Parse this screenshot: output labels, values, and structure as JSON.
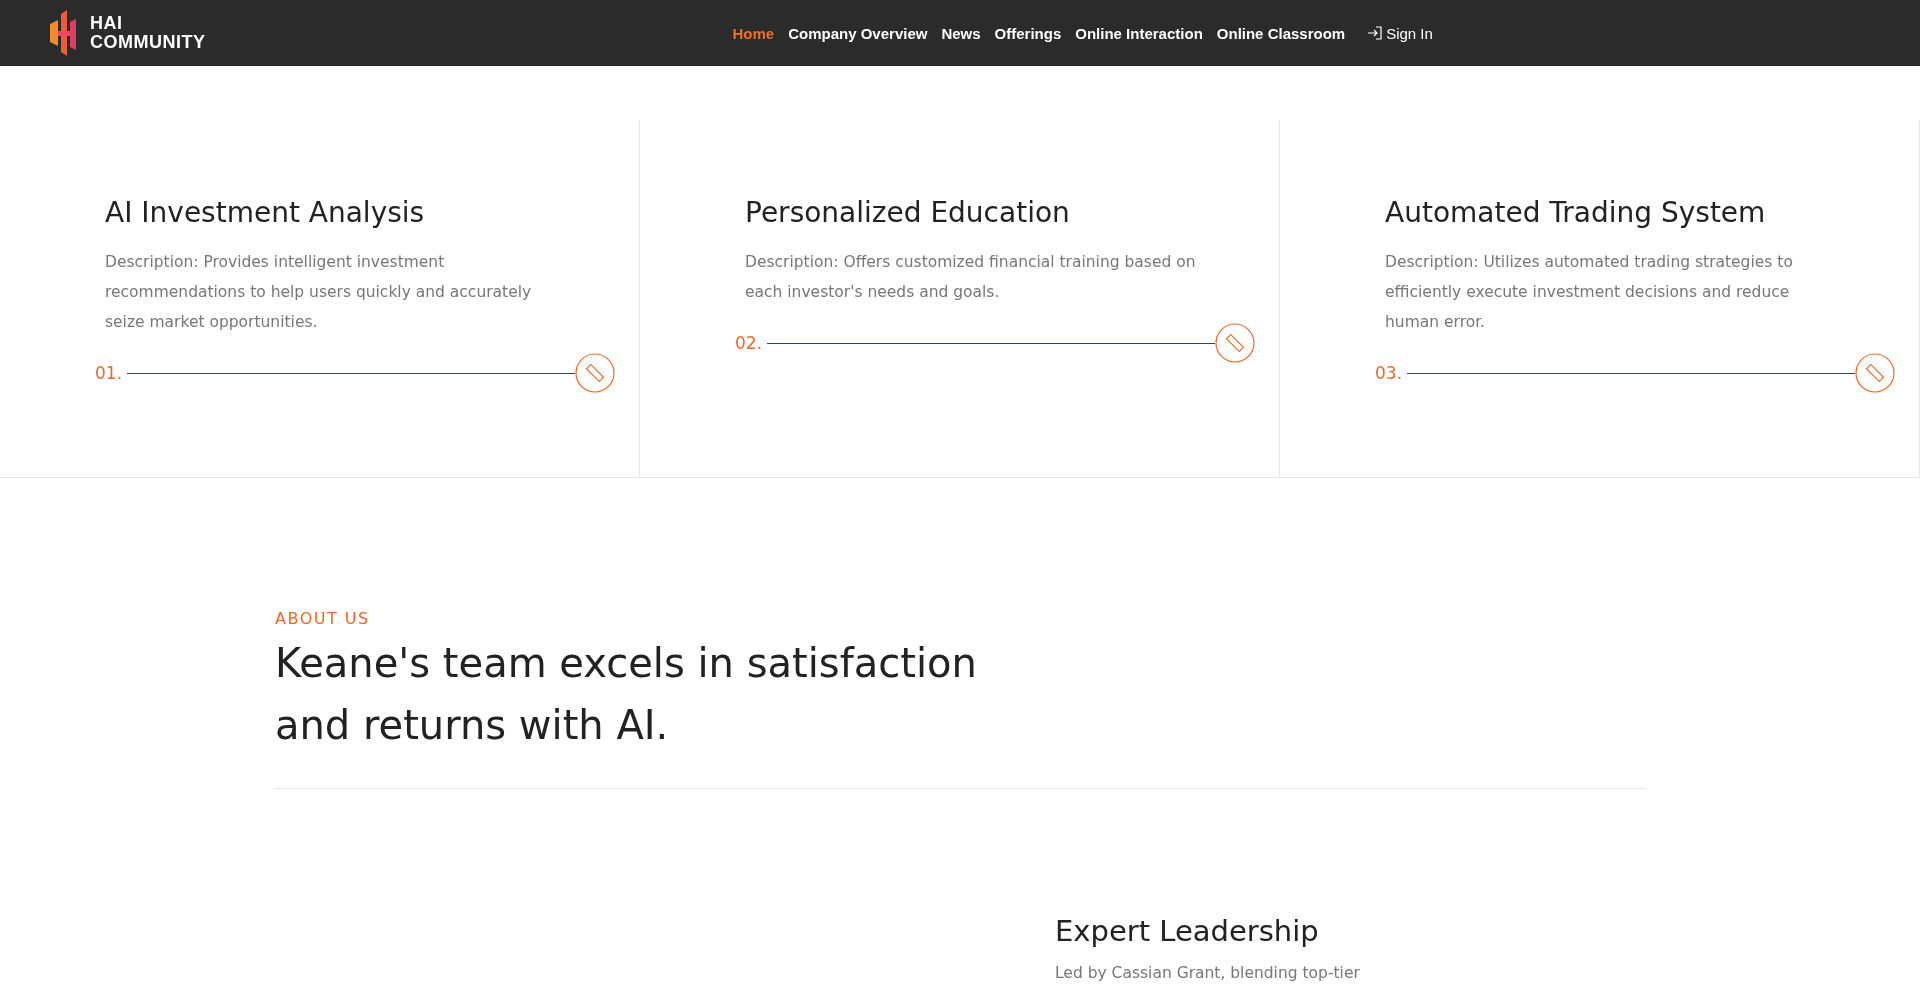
{
  "header": {
    "logo": {
      "line_1": "HAI",
      "line_2": "COMMUNITY"
    },
    "nav": [
      {
        "label": "Home",
        "selected": true
      },
      {
        "label": "Company Overview",
        "selected": false
      },
      {
        "label": "News",
        "selected": false
      },
      {
        "label": "Offerings",
        "selected": false
      },
      {
        "label": "Online Interaction",
        "selected": false
      },
      {
        "label": "Online Classroom",
        "selected": false
      }
    ],
    "sign_in": "Sign In"
  },
  "features": [
    {
      "title": "AI Investment Analysis",
      "description": "Description: Provides intelligent investment recommendations to help users quickly and accurately seize market opportunities.",
      "number": "01."
    },
    {
      "title": "Personalized Education",
      "description": "Description: Offers customized financial training based on each investor's needs and goals.",
      "number": "02."
    },
    {
      "title": "Automated Trading System",
      "description": "Description: Utilizes automated trading strategies to efficiently execute investment decisions and reduce human error.",
      "number": "03."
    }
  ],
  "about": {
    "eyebrow": "ABOUT US",
    "heading": "Keane's team excels in satisfaction and returns with AI."
  },
  "leadership": {
    "title": "Expert Leadership",
    "text": "Led by Cassian Grant, blending top-tier"
  }
}
